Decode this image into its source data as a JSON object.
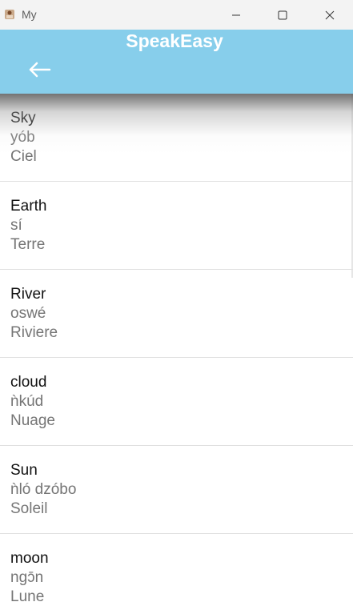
{
  "window": {
    "title": "My"
  },
  "appbar": {
    "title": "SpeakEasy",
    "back_icon": "arrow-left-icon"
  },
  "colors": {
    "appbar": "#87ceeb",
    "titlebar": "#f3f3f3",
    "primary_text": "#111111",
    "secondary_text": "#757575"
  },
  "words": [
    {
      "english": "Sky",
      "native": "yób",
      "french": "Ciel"
    },
    {
      "english": "Earth",
      "native": "sí",
      "french": "Terre"
    },
    {
      "english": "River",
      "native": "oswé",
      "french": "Riviere"
    },
    {
      "english": "cloud",
      "native": "ǹkúd",
      "french": "Nuage"
    },
    {
      "english": "Sun",
      "native": "ǹló dzóbo",
      "french": "Soleil"
    },
    {
      "english": "moon",
      "native": "ngɔ̄n",
      "french": "Lune"
    }
  ]
}
